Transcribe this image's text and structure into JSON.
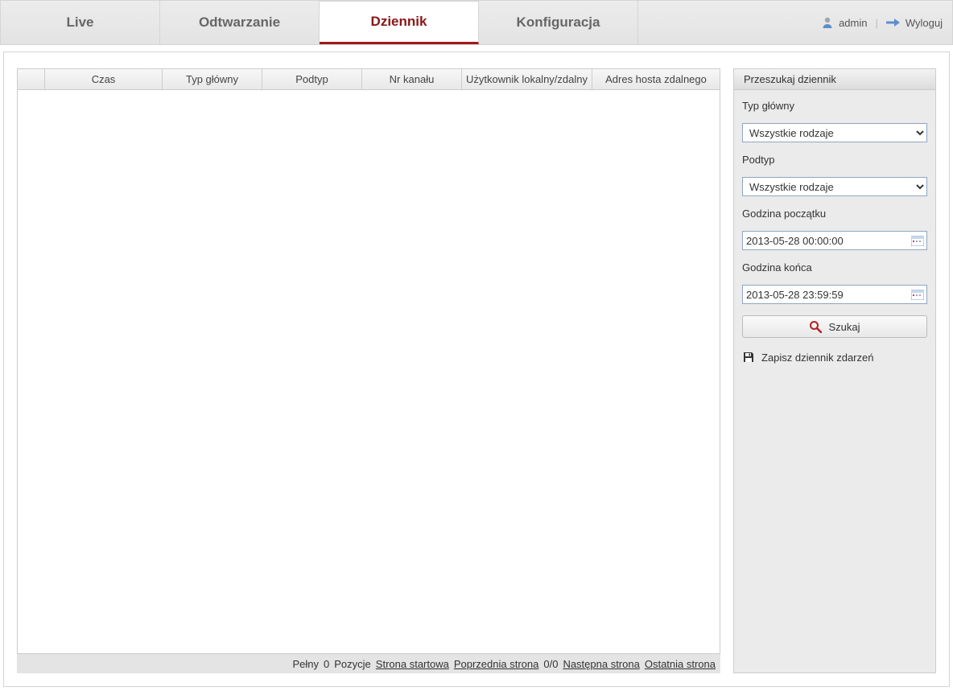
{
  "tabs": {
    "live": "Live",
    "playback": "Odtwarzanie",
    "log": "Dziennik",
    "config": "Konfiguracja"
  },
  "header": {
    "username": "admin",
    "logout": "Wyloguj"
  },
  "table": {
    "columns": {
      "idx": "",
      "time": "Czas",
      "majorType": "Typ główny",
      "subType": "Podtyp",
      "channel": "Nr kanału",
      "user": "Użytkownik lokalny/zdalny",
      "remoteHost": "Adres hosta zdalnego"
    }
  },
  "pager": {
    "totalPrefix": "Pełny",
    "totalCount": "0",
    "itemsLabel": "Pozycje",
    "first": "Strona startowa",
    "prev": "Poprzednia strona",
    "pageInfo": "0/0",
    "next": "Następna strona",
    "last": "Ostatnia strona"
  },
  "search": {
    "panelTitle": "Przeszukaj dziennik",
    "majorLabel": "Typ główny",
    "majorValue": "Wszystkie rodzaje",
    "subLabel": "Podtyp",
    "subValue": "Wszystkie rodzaje",
    "startLabel": "Godzina początku",
    "startValue": "2013-05-28 00:00:00",
    "endLabel": "Godzina końca",
    "endValue": "2013-05-28 23:59:59",
    "searchBtn": "Szukaj",
    "saveLog": "Zapisz dziennik zdarzeń"
  }
}
